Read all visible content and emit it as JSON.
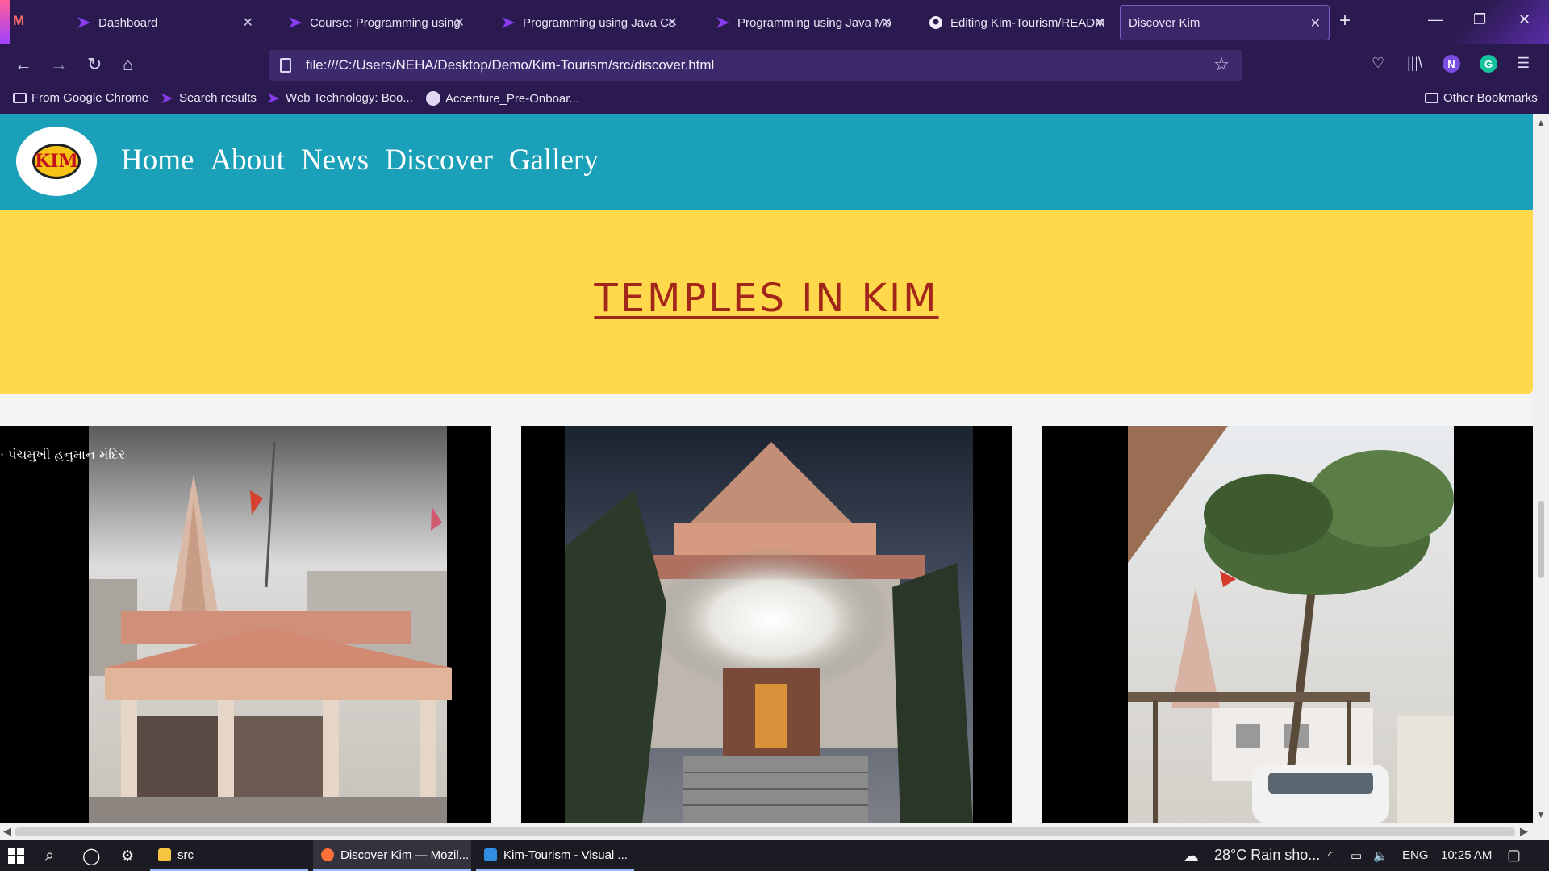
{
  "browser": {
    "tabs": [
      {
        "title": "Dashboard"
      },
      {
        "title": "Course: Programming using J"
      },
      {
        "title": "Programming using Java Con"
      },
      {
        "title": "Programming using Java Mo"
      },
      {
        "title": "Editing Kim-Tourism/READM"
      },
      {
        "title": "Discover Kim"
      }
    ],
    "new_tab": "+",
    "url": "file:///C:/Users/NEHA/Desktop/Demo/Kim-Tourism/src/discover.html",
    "profile_initial": "N",
    "grammarly_initial": "G",
    "bookmarks": [
      "From Google Chrome",
      "Search results",
      "Web Technology: Boo...",
      "Accenture_Pre-Onboar..."
    ],
    "other_bookmarks": "Other Bookmarks"
  },
  "site": {
    "logo_text": "KIM",
    "menu": [
      "Home",
      "About",
      "News",
      "Discover",
      "Gallery"
    ],
    "hero_title": "TEMPLES IN KIM",
    "cards": [
      {
        "caption": "· પંચમુખી હનુમાન મંદિર",
        "image": "temple-photo-1"
      },
      {
        "caption": "",
        "image": "temple-photo-2-night"
      },
      {
        "caption": "",
        "image": "temple-photo-3-palms"
      }
    ]
  },
  "taskbar": {
    "apps": [
      "src",
      "Discover Kim — Mozil...",
      "Kim-Tourism - Visual ..."
    ],
    "weather": "28°C  Rain sho...",
    "language": "ENG",
    "time": "10:25 AM"
  },
  "colors": {
    "browser_bg": "#2b1a4f",
    "site_nav": "#1aa0b8",
    "hero_bg": "#ffd84c",
    "hero_text": "#a3261b"
  }
}
